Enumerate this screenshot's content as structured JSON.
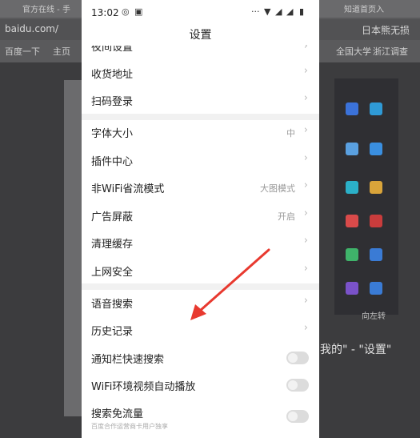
{
  "background": {
    "tabs": [
      "官方在线 - 手",
      "知道首页入"
    ],
    "address": "baidu.com/",
    "address_right": "日本熊无损",
    "bookmarks": [
      "百度一下",
      "主页",
      "全国大学",
      "浙江调查"
    ],
    "right_text": "我的\" - \"设置\"",
    "rotate_label": "向左转"
  },
  "status_bar": {
    "time": "13:02",
    "icons": [
      "weibo-icon",
      "image-icon",
      "dots-icon",
      "wifi-icon",
      "signal-icon",
      "signal-icon",
      "battery-icon"
    ]
  },
  "header": {
    "title": "设置"
  },
  "cut_row": {
    "label": "夜间设置"
  },
  "sections": [
    {
      "rows": [
        {
          "label": "收货地址",
          "type": "link"
        },
        {
          "label": "扫码登录",
          "type": "link"
        }
      ]
    },
    {
      "rows": [
        {
          "label": "字体大小",
          "value": "中",
          "type": "link"
        },
        {
          "label": "插件中心",
          "type": "link"
        },
        {
          "label": "非WiFi省流模式",
          "value": "大图模式",
          "type": "link"
        },
        {
          "label": "广告屏蔽",
          "value": "开启",
          "type": "link"
        },
        {
          "label": "清理缓存",
          "type": "link"
        },
        {
          "label": "上网安全",
          "type": "link"
        }
      ]
    },
    {
      "rows": [
        {
          "label": "语音搜索",
          "type": "link"
        },
        {
          "label": "历史记录",
          "type": "link"
        },
        {
          "label": "通知栏快速搜索",
          "type": "toggle",
          "on": false
        },
        {
          "label": "WiFi环境视频自动播放",
          "type": "toggle",
          "on": false
        },
        {
          "label": "搜索免流量",
          "sublabel": "百度合作运营商卡用户独享",
          "type": "toggle",
          "on": false
        }
      ]
    }
  ],
  "annotation": {
    "color": "#e8392f"
  }
}
